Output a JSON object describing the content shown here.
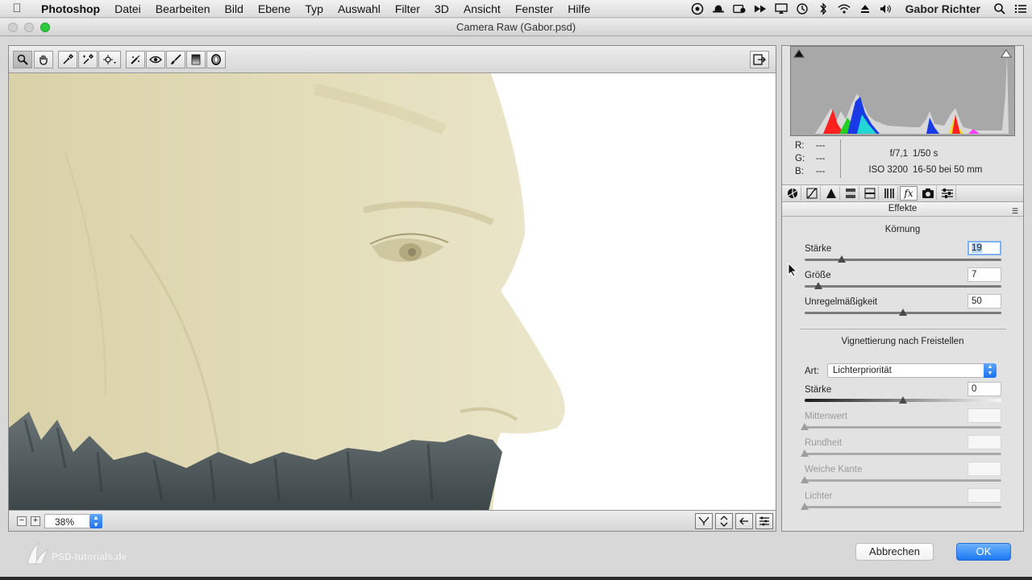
{
  "menubar": {
    "app": "Photoshop",
    "items": [
      "Datei",
      "Bearbeiten",
      "Bild",
      "Ebene",
      "Typ",
      "Auswahl",
      "Filter",
      "3D",
      "Ansicht",
      "Fenster",
      "Hilfe"
    ],
    "user": "Gabor Richter",
    "status_icons": [
      "creative-cloud-icon",
      "bowler-hat-icon",
      "camera-badge-icon",
      "arrows-icon",
      "airplay-icon",
      "time-machine-icon",
      "bluetooth-icon",
      "wifi-icon",
      "eject-icon",
      "volume-icon",
      "search-icon",
      "list-icon"
    ]
  },
  "window": {
    "title": "Camera Raw (Gabor.psd)"
  },
  "toolbar": {
    "tools": [
      "zoom-tool-icon",
      "hand-tool-icon",
      "white-balance-tool-icon",
      "color-sampler-tool-icon",
      "targeted-adjustment-tool-icon",
      "spot-removal-tool-icon",
      "red-eye-tool-icon",
      "adjustment-brush-icon",
      "graduated-filter-icon",
      "radial-filter-icon"
    ],
    "open_icon": "open-preferences-icon"
  },
  "statusbar": {
    "zoom": "38%"
  },
  "info": {
    "r_label": "R:",
    "g_label": "G:",
    "b_label": "B:",
    "r": "---",
    "g": "---",
    "b": "---",
    "aperture": "f/7,1",
    "shutter": "1/50 s",
    "iso": "ISO 3200",
    "lens": "16-50 bei 50 mm"
  },
  "panel": {
    "tabs": [
      "basic-icon",
      "tone-curve-icon",
      "detail-icon",
      "hsl-icon",
      "split-toning-icon",
      "lens-corrections-icon",
      "effects-icon",
      "camera-calibration-icon",
      "presets-icon"
    ],
    "section_title": "Effekte",
    "grain_title": "Körnung",
    "grain": [
      {
        "label": "Stärke",
        "value": "19",
        "pos": 0.19
      },
      {
        "label": "Größe",
        "value": "7",
        "pos": 0.07
      },
      {
        "label": "Unregelmäßigkeit",
        "value": "50",
        "pos": 0.5
      }
    ],
    "vignette_title": "Vignettierung nach Freistellen",
    "style_label": "Art:",
    "style_value": "Lichterpriorität",
    "vignette": [
      {
        "label": "Stärke",
        "value": "0",
        "pos": 0.5
      },
      {
        "label": "Mittenwert",
        "value": "",
        "pos": 0
      },
      {
        "label": "Rundheit",
        "value": "",
        "pos": 0
      },
      {
        "label": "Weiche Kante",
        "value": "",
        "pos": 0
      },
      {
        "label": "Lichter",
        "value": "",
        "pos": 0
      }
    ]
  },
  "buttons": {
    "cancel": "Abbrechen",
    "ok": "OK"
  },
  "watermark": "PSD-tutorials.de",
  "colors": {
    "ok_blue": "#1c78f2",
    "canvas_skin": "#e2dcb8",
    "beard": "#4a5458"
  }
}
